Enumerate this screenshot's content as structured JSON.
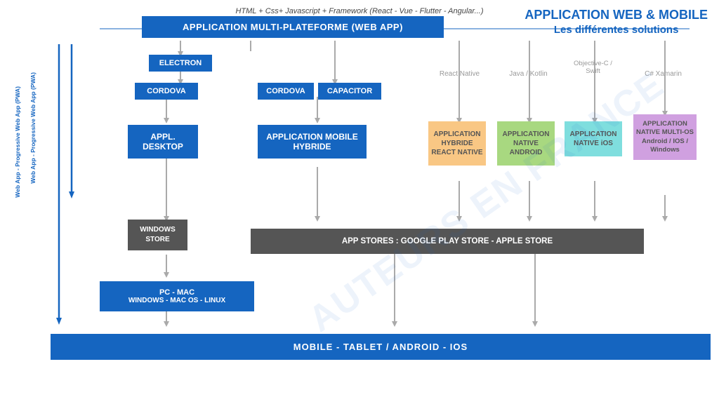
{
  "top_subtitle": "HTML + Css+ Javascript + Framework (React - Vue - Flutter - Angular...)",
  "title": {
    "line1": "APPLICATION WEB & MOBILE",
    "line2": "Les différentes solutions"
  },
  "watermark": "AUTEURS EN FRANCE",
  "top_bar": "APPLICATION MULTI-PLATEFORME  (WEB APP)",
  "bottom_bar": "MOBILE  -  TABLET  /  ANDROID  -  IOS",
  "labels": {
    "electron": "ELECTRON",
    "cordova1": "CORDOVA",
    "cordova2": "CORDOVA",
    "capacitor": "CAPACITOR",
    "appl_desktop": "APPL. DESKTOP",
    "app_mobile_hybride": "APPLICATION MOBILE HYBRIDE",
    "react_native_col": "React Native",
    "java_col": "Java / Kotlin",
    "swift_col": "Objective-C / Swift",
    "xamarin_col": "C# Xamarin",
    "app_react_native": "APPLICATION HYBRIDE REACT NATIVE",
    "app_android": "APPLICATION NATIVE ANDROID",
    "app_ios": "APPLICATION NATIVE iOS",
    "app_multiplatform": "APPLICATION NATIVE MULTI-OS Android / IOS / Windows",
    "windows_store": "WINDOWS STORE",
    "app_stores": "APP STORES  :  GOOGLE PLAY STORE  -  APPLE STORE",
    "pc_mac": "PC  -  MAC\nWINDOWS  -  MAC OS  -  LINUX",
    "webapp_label": "Web App - Progressive Web App (PWA)",
    "pwa_label": "Web App - Progressive Web App (PWA)"
  },
  "colors": {
    "blue": "#1565c0",
    "dark_grey": "#555555",
    "orange": "#f9c784",
    "green": "#a8d880",
    "cyan": "#7fdede",
    "purple": "#d0a0e0",
    "arrow": "#999999"
  }
}
